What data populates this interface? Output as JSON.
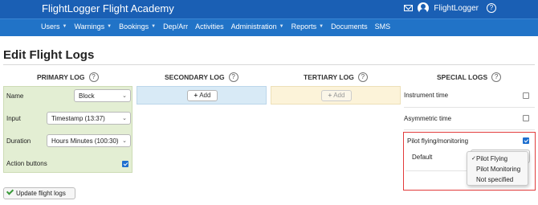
{
  "header": {
    "app_title": "FlightLogger Flight Academy",
    "user_name": "FlightLogger",
    "help_glyph": "?"
  },
  "nav": {
    "items": [
      {
        "label": "Users",
        "has_menu": true
      },
      {
        "label": "Warnings",
        "has_menu": true
      },
      {
        "label": "Bookings",
        "has_menu": true
      },
      {
        "label": "Dep/Arr",
        "has_menu": false
      },
      {
        "label": "Activities",
        "has_menu": false
      },
      {
        "label": "Administration",
        "has_menu": true
      },
      {
        "label": "Reports",
        "has_menu": true
      },
      {
        "label": "Documents",
        "has_menu": false
      },
      {
        "label": "SMS",
        "has_menu": false
      }
    ]
  },
  "page": {
    "title": "Edit Flight Logs"
  },
  "columns": {
    "primary": "PRIMARY LOG",
    "secondary": "SECONDARY LOG",
    "tertiary": "TERTIARY LOG",
    "special": "SPECIAL LOGS",
    "help_glyph": "?"
  },
  "primary_log": {
    "name_label": "Name",
    "name_value": "Block",
    "input_label": "Input",
    "input_value": "Timestamp (13:37)",
    "duration_label": "Duration",
    "duration_value": "Hours Minutes (100:30)",
    "action_buttons_label": "Action buttons",
    "action_buttons_checked": true
  },
  "secondary_log": {
    "add_label": "Add"
  },
  "tertiary_log": {
    "add_label": "Add",
    "add_disabled": true
  },
  "special_logs": {
    "instrument_time_label": "Instrument time",
    "instrument_time_checked": false,
    "asymmetric_time_label": "Asymmetric time",
    "asymmetric_time_checked": false,
    "pilot_flying_label": "Pilot flying/monitoring",
    "pilot_flying_checked": true,
    "default_label": "Default",
    "dropdown_options": [
      {
        "label": "Pilot Flying",
        "selected": true
      },
      {
        "label": "Pilot Monitoring",
        "selected": false
      },
      {
        "label": "Not specified",
        "selected": false
      }
    ]
  },
  "actions": {
    "update_label": "Update flight logs"
  },
  "colors": {
    "header_bg": "#1a5fb4",
    "nav_bg": "#2173c7",
    "primary_panel": "#e3eed3",
    "secondary_panel": "#d8eaf6",
    "tertiary_panel": "#fcf3d9",
    "highlight_border": "#e23b3b",
    "checkbox_checked": "#1e6fcf"
  }
}
